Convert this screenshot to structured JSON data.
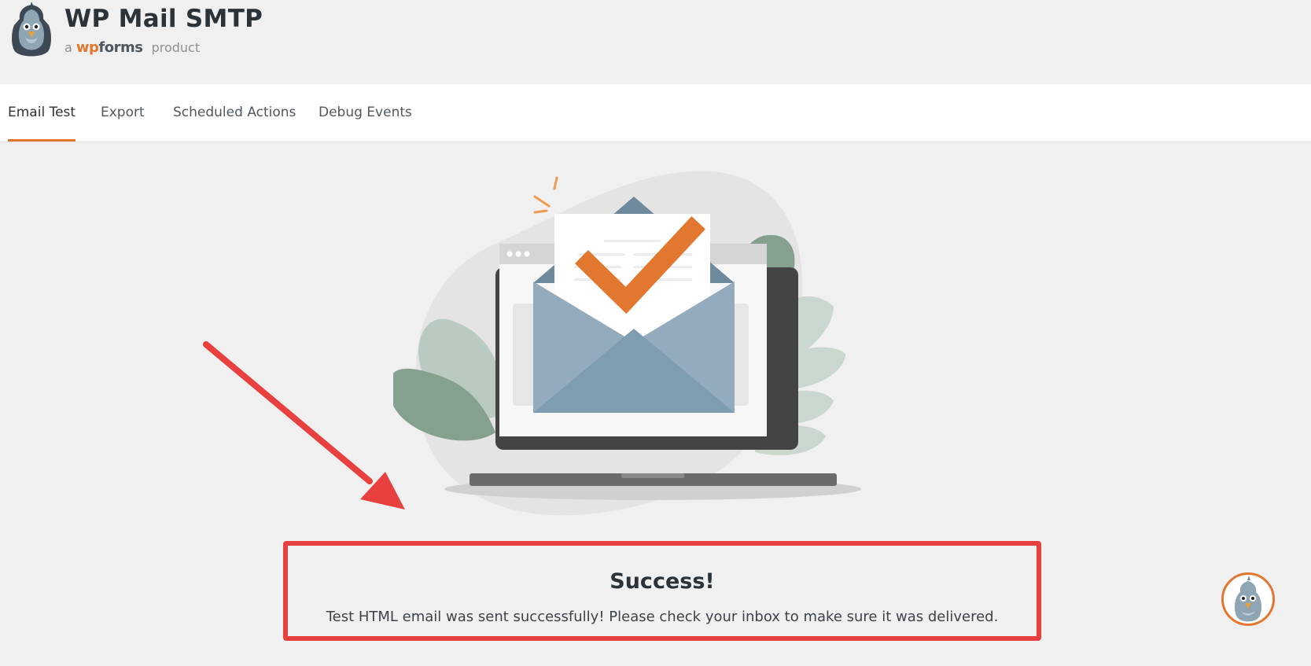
{
  "brand": {
    "title": "WP Mail SMTP",
    "sub_prefix": "a",
    "sub_wp": "wp",
    "sub_forms": "forms",
    "sub_suffix": "product",
    "accent_color": "#e27730"
  },
  "tabs": [
    {
      "label": "Email Test",
      "active": true
    },
    {
      "label": "Export",
      "active": false
    },
    {
      "label": "Scheduled Actions",
      "active": false
    },
    {
      "label": "Debug Events",
      "active": false
    }
  ],
  "result": {
    "title": "Success!",
    "message": "Test HTML email was sent successfully! Please check your inbox to make sure it was delivered.",
    "highlight_color": "#e8403f"
  },
  "icons": {
    "logo": "pigeon-mascot-icon",
    "illustration": "email-sent-checkmark-icon",
    "annotation": "red-arrow-icon",
    "help": "pigeon-help-icon"
  }
}
